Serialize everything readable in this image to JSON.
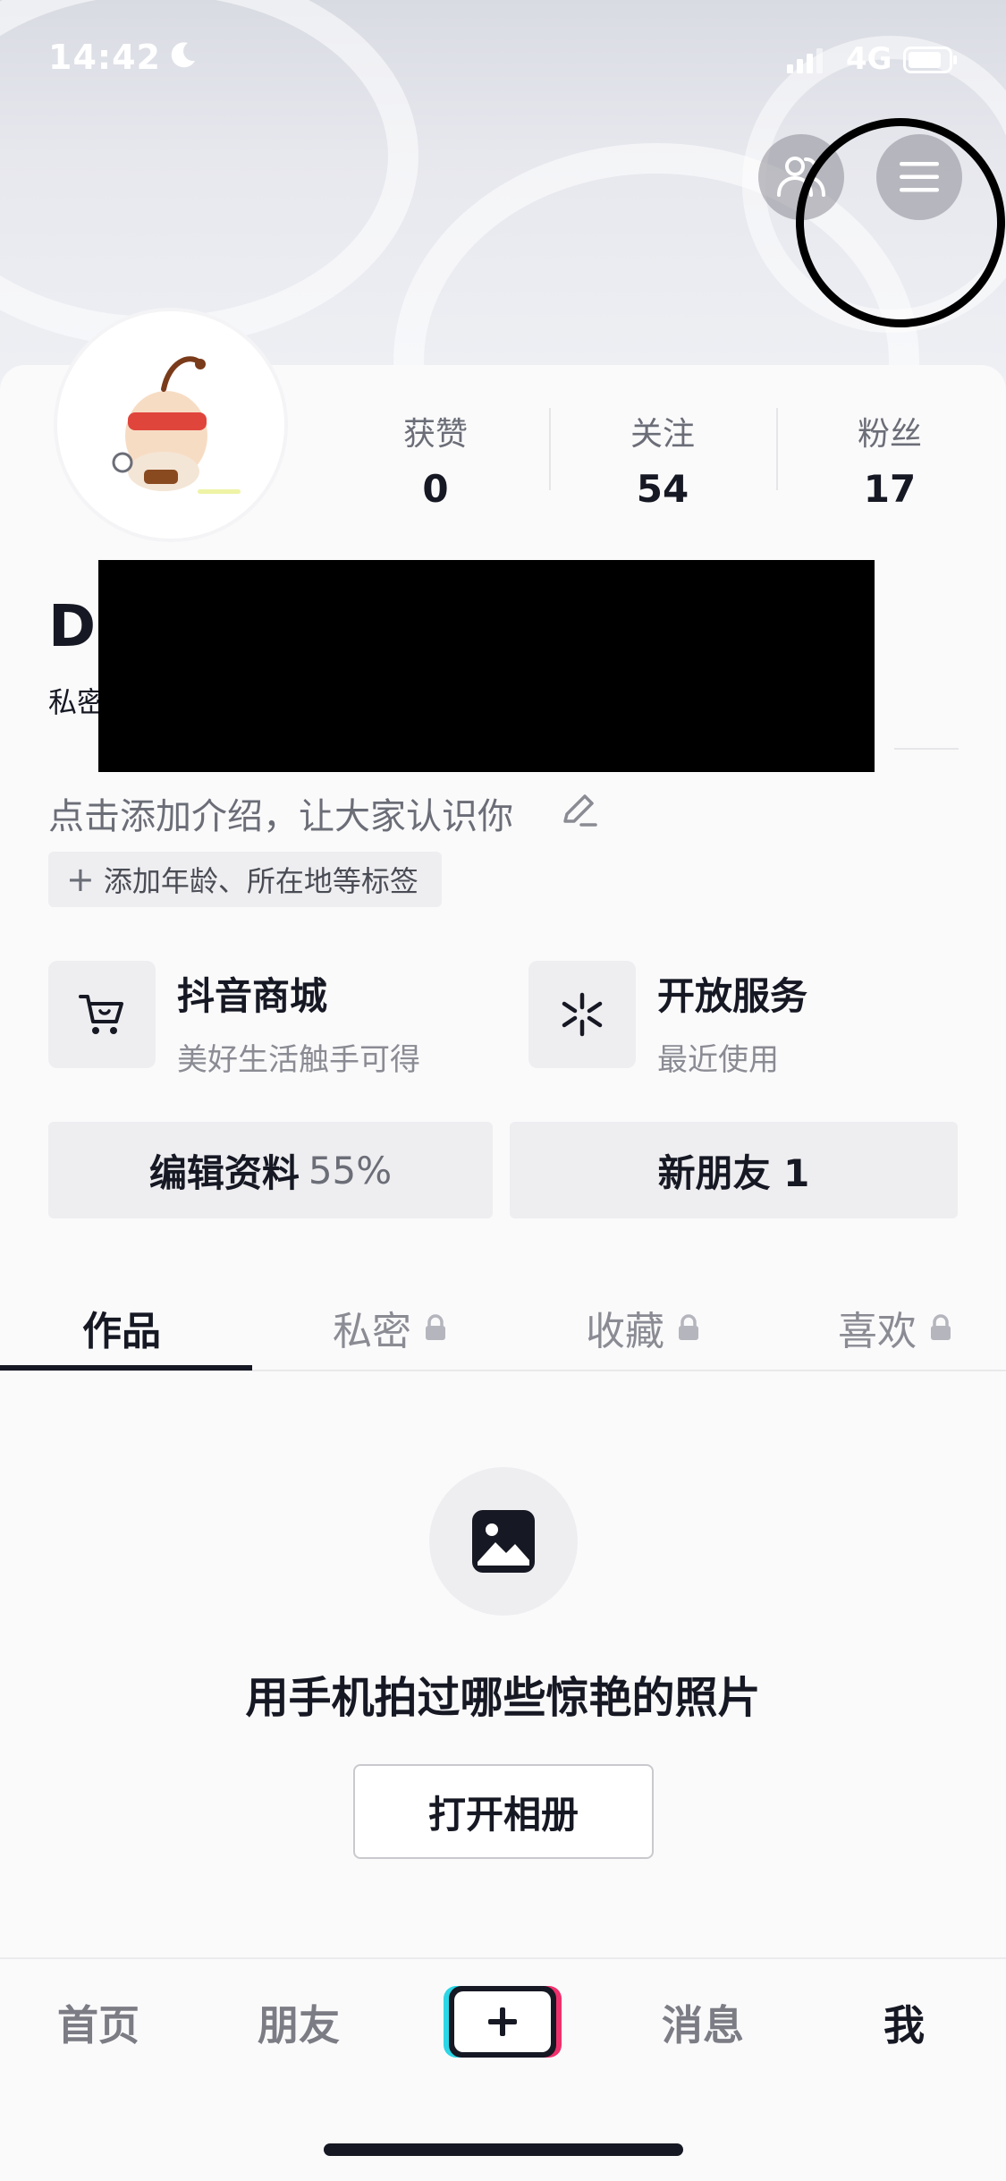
{
  "status_bar": {
    "time": "14:42",
    "network": "4G"
  },
  "profile": {
    "stats": [
      {
        "label": "获赞",
        "value": "0"
      },
      {
        "label": "关注",
        "value": "54"
      },
      {
        "label": "粉丝",
        "value": "17"
      }
    ],
    "username_visible": "Di",
    "account_type_visible": "私密",
    "bio_prompt": "点击添加介绍，让大家认识你",
    "tag_chip": "添加年龄、所在地等标签"
  },
  "services": [
    {
      "title": "抖音商城",
      "subtitle": "美好生活触手可得"
    },
    {
      "title": "开放服务",
      "subtitle": "最近使用"
    }
  ],
  "actions": {
    "edit_profile": "编辑资料",
    "edit_profile_pct": "55%",
    "new_friends": "新朋友 1"
  },
  "tabs": [
    "作品",
    "私密",
    "收藏",
    "喜欢"
  ],
  "empty_state": {
    "text": "用手机拍过哪些惊艳的照片",
    "button": "打开相册"
  },
  "bottom_nav": {
    "home": "首页",
    "friends": "朋友",
    "messages": "消息",
    "me": "我"
  }
}
